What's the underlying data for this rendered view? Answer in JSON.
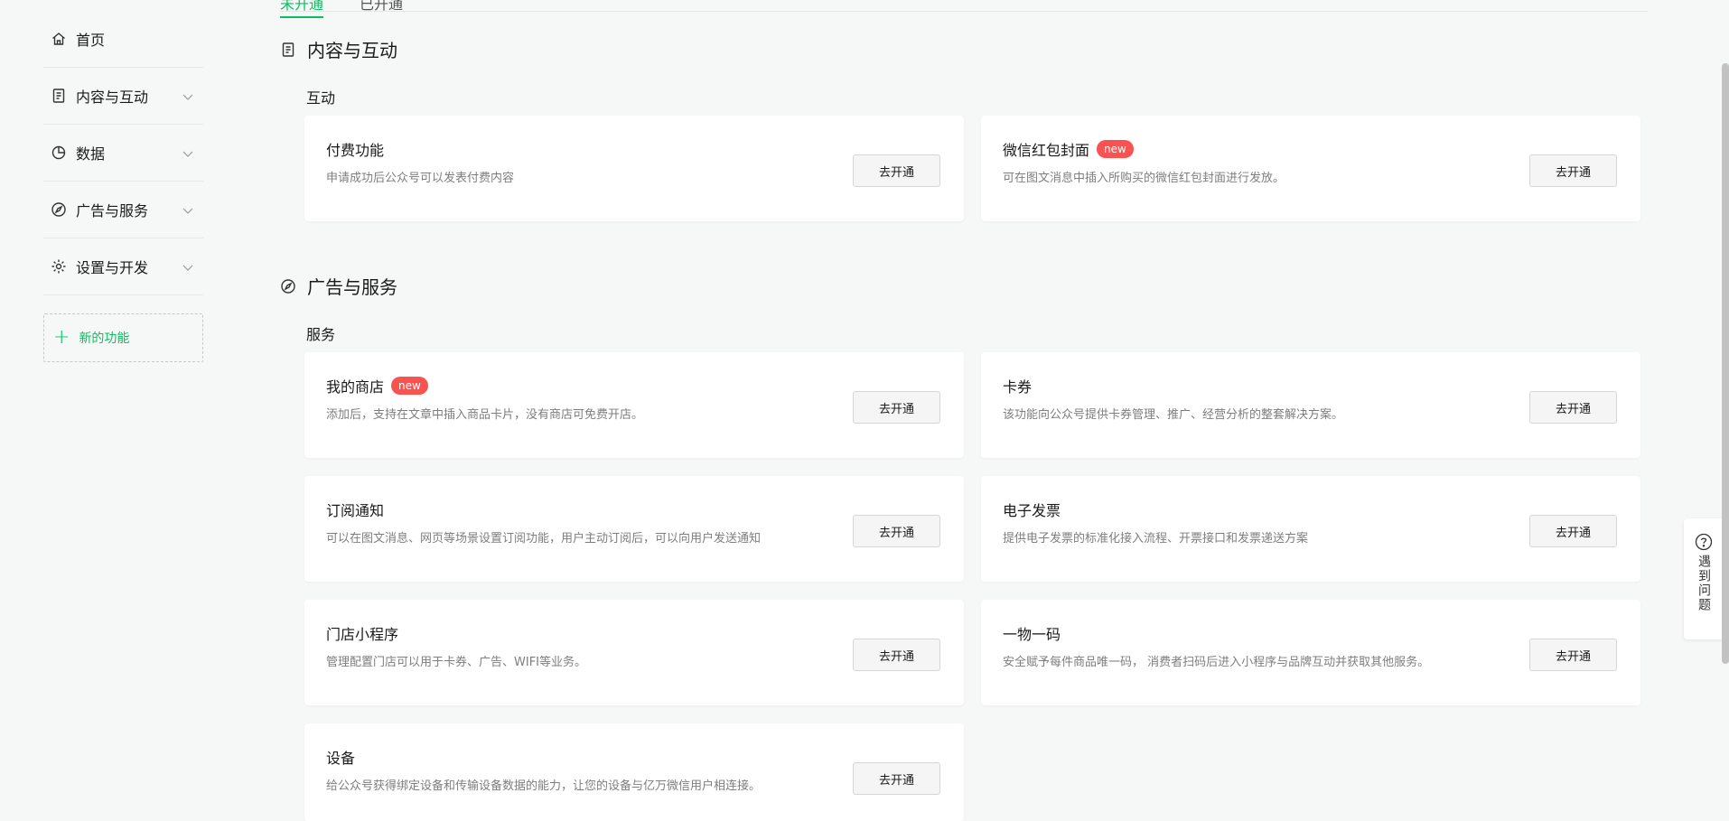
{
  "sidebar": {
    "items": [
      {
        "label": "首页",
        "icon": "home-icon"
      },
      {
        "label": "内容与互动",
        "icon": "document-icon"
      },
      {
        "label": "数据",
        "icon": "pie-chart-icon"
      },
      {
        "label": "广告与服务",
        "icon": "compass-icon"
      },
      {
        "label": "设置与开发",
        "icon": "gear-icon"
      }
    ],
    "new_function": "新的功能"
  },
  "tabs": [
    "未开通",
    "已开通"
  ],
  "sections": [
    {
      "title": "内容与互动",
      "subtitle": "互动",
      "cards": [
        {
          "name": "付费功能",
          "desc": "申请成功后公众号可以发表付费内容",
          "button": "去开通"
        },
        {
          "name": "微信红包封面",
          "badge": "new",
          "desc": "可在图文消息中插入所购买的微信红包封面进行发放。",
          "button": "去开通"
        }
      ]
    },
    {
      "title": "广告与服务",
      "subtitle": "服务",
      "cards": [
        {
          "name": "我的商店",
          "badge": "new",
          "desc": "添加后，支持在文章中插入商品卡片，没有商店可免费开店。",
          "button": "去开通"
        },
        {
          "name": "卡券",
          "desc": "该功能向公众号提供卡券管理、推广、经营分析的整套解决方案。",
          "button": "去开通"
        },
        {
          "name": "订阅通知",
          "desc": "可以在图文消息、网页等场景设置订阅功能，用户主动订阅后，可以向用户发送通知",
          "button": "去开通"
        },
        {
          "name": "电子发票",
          "desc": "提供电子发票的标准化接入流程、开票接口和发票递送方案",
          "button": "去开通"
        },
        {
          "name": "门店小程序",
          "desc": "管理配置门店可以用于卡券、广告、WIFI等业务。",
          "button": "去开通"
        },
        {
          "name": "一物一码",
          "desc": "安全赋予每件商品唯一码， 消费者扫码后进入小程序与品牌互动并获取其他服务。",
          "button": "去开通"
        },
        {
          "name": "设备",
          "desc": "给公众号获得绑定设备和传输设备数据的能力，让您的设备与亿万微信用户相连接。",
          "button": "去开通"
        }
      ]
    }
  ],
  "help": {
    "label": "遇到问题",
    "icon": "question-circle-icon"
  },
  "colors": {
    "accent": "#07c160",
    "badge": "#fa5151",
    "background": "#f6f7f7"
  }
}
